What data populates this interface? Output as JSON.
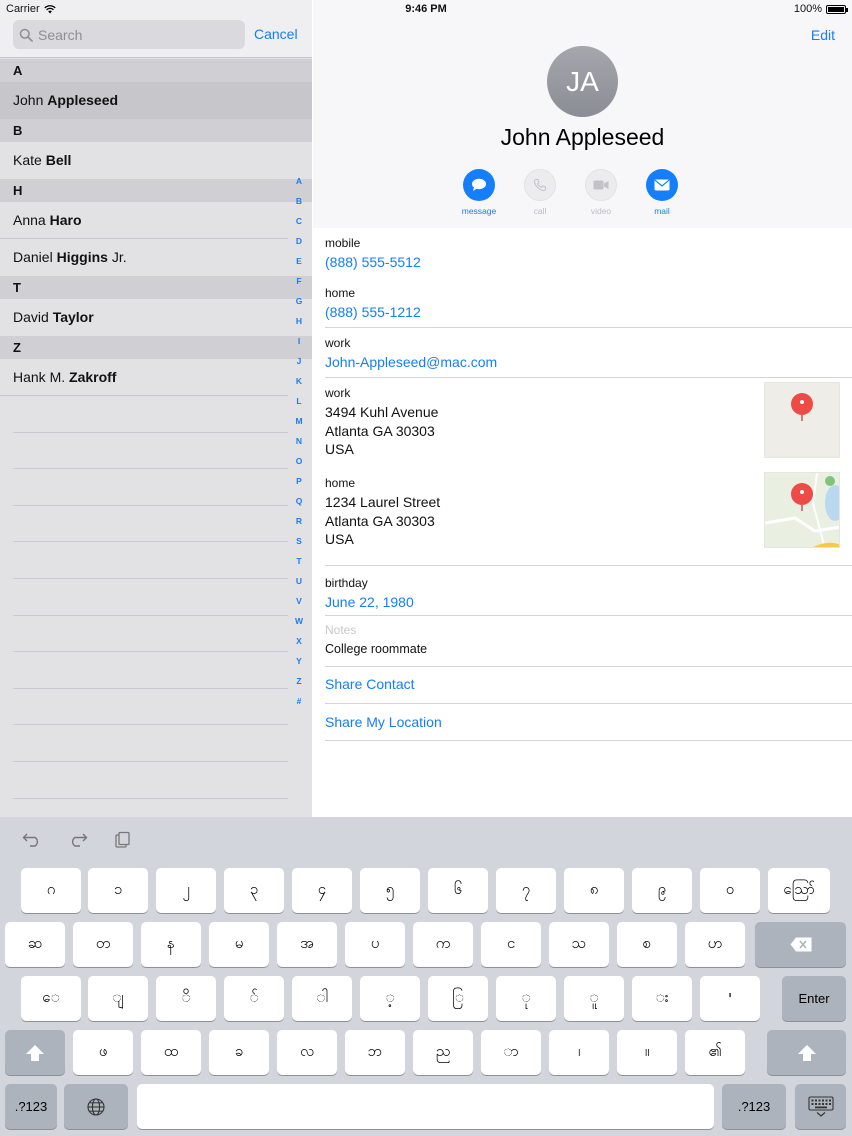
{
  "status": {
    "carrier": "Carrier",
    "time": "9:46 PM",
    "battery": "100%"
  },
  "search": {
    "placeholder": "Search",
    "cancel_label": "Cancel"
  },
  "contacts_sections": [
    {
      "letter": "A",
      "rows": [
        {
          "first": "John",
          "last": "Appleseed",
          "selected": true
        }
      ]
    },
    {
      "letter": "B",
      "rows": [
        {
          "first": "Kate",
          "last": "Bell"
        }
      ]
    },
    {
      "letter": "H",
      "rows": [
        {
          "first": "Anna",
          "last": "Haro"
        },
        {
          "first": "Daniel",
          "last": "Higgins",
          "suffix": "Jr."
        }
      ]
    },
    {
      "letter": "T",
      "rows": [
        {
          "first": "David",
          "last": "Taylor"
        }
      ]
    },
    {
      "letter": "Z",
      "rows": [
        {
          "first": "Hank M.",
          "last": "Zakroff"
        }
      ]
    }
  ],
  "index_letters": [
    "A",
    "B",
    "C",
    "D",
    "E",
    "F",
    "G",
    "H",
    "I",
    "J",
    "K",
    "L",
    "M",
    "N",
    "O",
    "P",
    "Q",
    "R",
    "S",
    "T",
    "U",
    "V",
    "W",
    "X",
    "Y",
    "Z",
    "#"
  ],
  "detail": {
    "edit_label": "Edit",
    "initials": "JA",
    "name": "John Appleseed",
    "actions": [
      {
        "id": "message",
        "label": "message",
        "icon": "message-icon",
        "enabled": true
      },
      {
        "id": "call",
        "label": "call",
        "icon": "phone-icon",
        "enabled": false
      },
      {
        "id": "video",
        "label": "video",
        "icon": "video-icon",
        "enabled": false
      },
      {
        "id": "mail",
        "label": "mail",
        "icon": "mail-icon",
        "enabled": true
      }
    ],
    "mobile_label": "mobile",
    "mobile_value": "(888) 555-5512",
    "home_phone_label": "home",
    "home_phone_value": "(888) 555-1212",
    "work_email_label": "work",
    "work_email_value": "John-Appleseed@mac.com",
    "work_address_label": "work",
    "work_address_lines": [
      "3494 Kuhl Avenue",
      "Atlanta GA 30303",
      "USA"
    ],
    "home_address_label": "home",
    "home_address_lines": [
      "1234 Laurel Street",
      "Atlanta GA 30303",
      "USA"
    ],
    "birthday_label": "birthday",
    "birthday_value": "June 22, 1980",
    "notes_label": "Notes",
    "notes_value": "College roommate",
    "share_contact": "Share Contact",
    "share_location": "Share My Location"
  },
  "keyboard": {
    "tools": [
      "undo-icon",
      "redo-icon",
      "paste-icon"
    ],
    "row1": [
      "၁",
      "၂",
      "၃",
      "၄",
      "၅",
      "၆",
      "၇",
      "၈",
      "၉",
      "၀",
      "ဪ"
    ],
    "row1_first": "ဂ",
    "row2": [
      "ဆ",
      "တ",
      "န",
      "မ",
      "အ",
      "ပ",
      "က",
      "င",
      "သ",
      "စ",
      "ဟ"
    ],
    "row3": [
      "ေ",
      "ျ",
      "ိ",
      "်",
      "ါ",
      "့",
      "ြ",
      "ု",
      "ူ",
      "း",
      "'"
    ],
    "row4": [
      "ဖ",
      "ထ",
      "ခ",
      "လ",
      "ဘ",
      "ည",
      "ာ",
      "၊",
      "။",
      "၏"
    ],
    "enter_label": "Enter",
    "numbers_label": ".?123",
    "colors": {
      "key": "#ffffff",
      "special_key": "#adb3bc",
      "background": "#d2d5db",
      "accent": "#147efb"
    }
  }
}
